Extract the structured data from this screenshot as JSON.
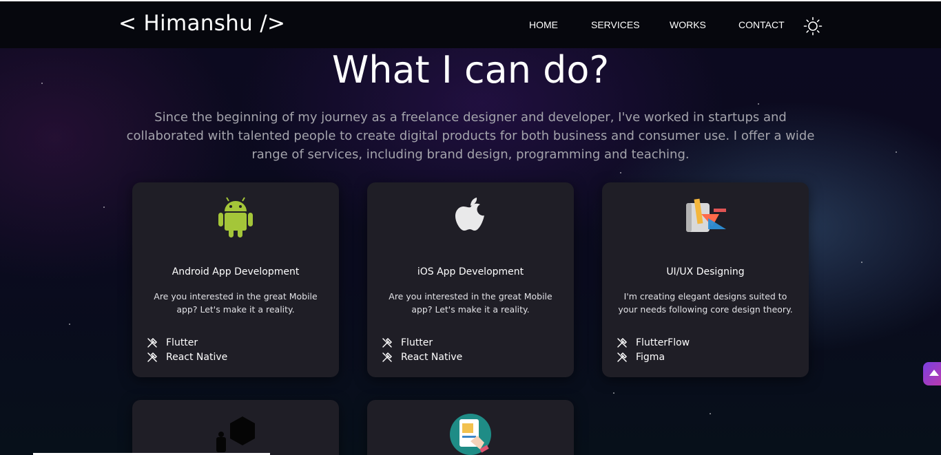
{
  "header": {
    "brand": "< Himanshu />",
    "nav": [
      "HOME",
      "SERVICES",
      "WORKS",
      "CONTACT"
    ],
    "theme_toggle_icon": "sun-icon"
  },
  "hero": {
    "title": "What I can do?",
    "intro": "Since the beginning of my journey as a freelance designer and developer, I've worked in startups and collaborated with talented people to create digital products for both business and consumer use. I offer a wide range of services, including brand design, programming and teaching."
  },
  "services": [
    {
      "icon": "android-icon",
      "title": "Android App Development",
      "description": "Are you interested in the great Mobile app? Let's make it a reality.",
      "tools": [
        "Flutter",
        "React Native"
      ]
    },
    {
      "icon": "apple-icon",
      "title": "iOS App Development",
      "description": "Are you interested in the great Mobile app? Let's make it a reality.",
      "tools": [
        "Flutter",
        "React Native"
      ]
    },
    {
      "icon": "design-tools-icon",
      "title": "UI/UX Designing",
      "description": "I'm creating elegant designs suited to your needs following core design theory.",
      "tools": [
        "FlutterFlow",
        "Figma"
      ]
    },
    {
      "icon": "hexagon-icon"
    },
    {
      "icon": "web-design-icon"
    }
  ],
  "colors": {
    "accent_android": "#a4c639",
    "card_bg": "#1f1e26",
    "scroll_button": "#7b3fe0"
  },
  "scroll_top_icon": "arrow-up-icon"
}
